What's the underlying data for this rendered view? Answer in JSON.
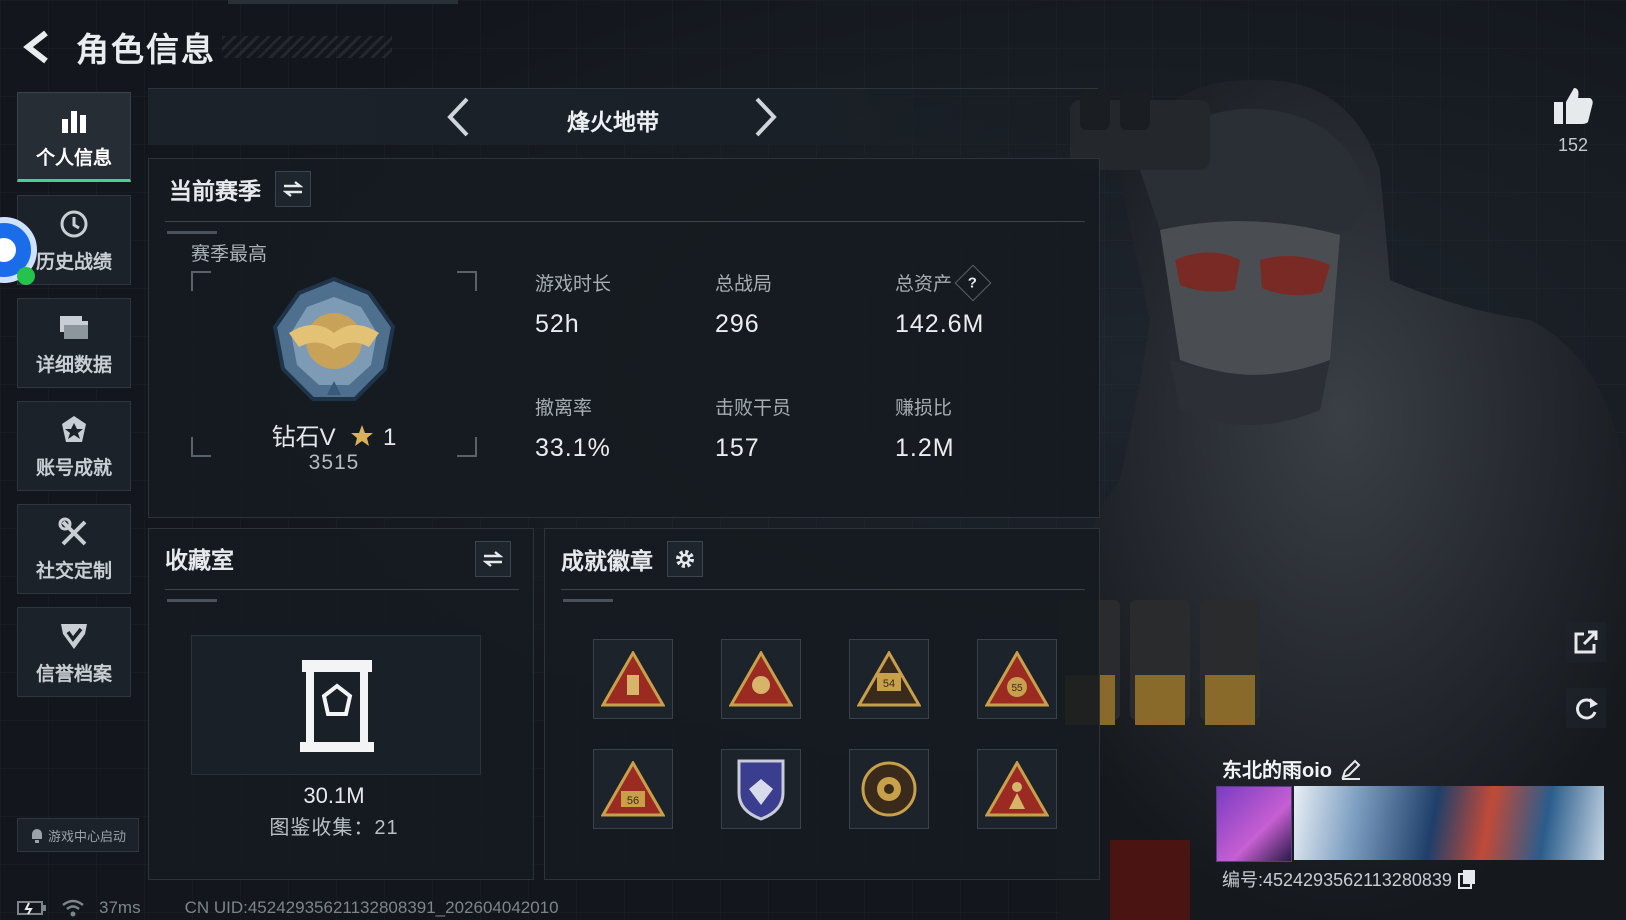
{
  "header": {
    "title": "角色信息"
  },
  "sidebar": {
    "items": [
      {
        "label": "个人信息",
        "icon": "bar-chart-icon",
        "active": true
      },
      {
        "label": "历史战绩",
        "icon": "clock-history-icon",
        "active": false
      },
      {
        "label": "详细数据",
        "icon": "folder-icon",
        "active": false
      },
      {
        "label": "账号成就",
        "icon": "achievement-icon",
        "active": false
      },
      {
        "label": "社交定制",
        "icon": "wrench-screwdriver-icon",
        "active": false
      },
      {
        "label": "信誉档案",
        "icon": "shield-check-icon",
        "active": false
      }
    ],
    "game_center_label": "游戏中心启动"
  },
  "mode_switcher": {
    "name": "烽火地带"
  },
  "season_panel": {
    "title": "当前赛季",
    "subtitle": "赛季最高",
    "rank_name": "钻石V",
    "rank_stars": "1",
    "rank_score": "3515",
    "stats": [
      {
        "label": "游戏时长",
        "value": "52h"
      },
      {
        "label": "总战局",
        "value": "296"
      },
      {
        "label": "总资产",
        "value": "142.6M",
        "help": "?"
      },
      {
        "label": "撤离率",
        "value": "33.1%"
      },
      {
        "label": "击败干员",
        "value": "157"
      },
      {
        "label": "赚损比",
        "value": "1.2M"
      }
    ]
  },
  "collection_panel": {
    "title": "收藏室",
    "value": "30.1M",
    "count_text": "图鉴收集：21"
  },
  "badges_panel": {
    "title": "成就徽章",
    "badge_numbers": [
      "",
      "",
      "54",
      "55",
      "56",
      "",
      "",
      ""
    ]
  },
  "profile": {
    "likes": "152",
    "player_name": "东北的雨oio",
    "player_id": "编号:4524293562113280839"
  },
  "footer": {
    "latency": "37ms",
    "uid_line": "CN UID:45242935621132808391_202604042010"
  },
  "colors": {
    "accent": "#40d48d",
    "badge_red": "#9b2b22",
    "badge_gold": "#c8a04a"
  }
}
